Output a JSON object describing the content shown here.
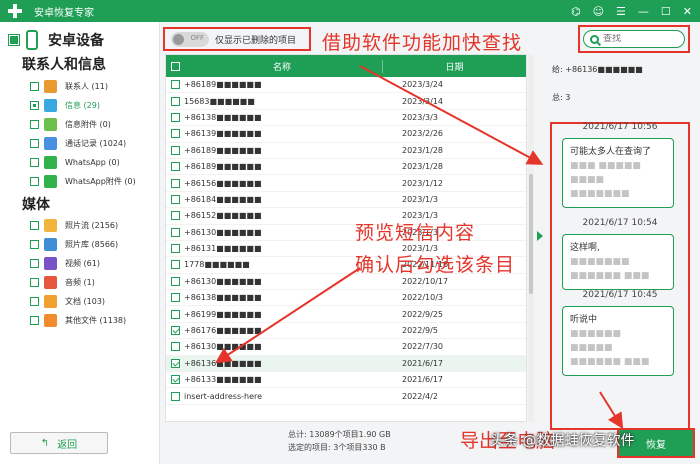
{
  "titlebar": {
    "title": "安卓恢复专家",
    "icons": [
      "wifi-icon",
      "chat-icon",
      "menu-icon",
      "minimize-icon",
      "maximize-icon",
      "close-icon"
    ]
  },
  "sidebar": {
    "device_name": "安卓设备",
    "section_contacts": "联系人和信息",
    "contacts_items": [
      {
        "label": "联系人 (11)",
        "icon": "contacts-icon",
        "color": "#e89a2e"
      },
      {
        "label": "信息 (29)",
        "icon": "messages-icon",
        "color": "#3aa7e0"
      },
      {
        "label": "信息附件 (0)",
        "icon": "attachment-icon",
        "color": "#6cc04a"
      },
      {
        "label": "通话记录 (1024)",
        "icon": "call-log-icon",
        "color": "#4a90e2"
      },
      {
        "label": "WhatsApp (0)",
        "icon": "whatsapp-icon",
        "color": "#2fb34a"
      },
      {
        "label": "WhatsApp附件 (0)",
        "icon": "whatsapp-attachment-icon",
        "color": "#2fb34a"
      }
    ],
    "section_media": "媒体",
    "media_items": [
      {
        "label": "照片流 (2156)",
        "icon": "photo-stream-icon",
        "color": "#f0b53a"
      },
      {
        "label": "照片库 (8566)",
        "icon": "photo-library-icon",
        "color": "#3f8fd8"
      },
      {
        "label": "视频 (61)",
        "icon": "video-icon",
        "color": "#7a52c7"
      },
      {
        "label": "音频 (1)",
        "icon": "audio-icon",
        "color": "#e6553d"
      },
      {
        "label": "文档 (103)",
        "icon": "document-icon",
        "color": "#f0a02e"
      },
      {
        "label": "其他文件 (1138)",
        "icon": "other-files-icon",
        "color": "#f08b2e"
      }
    ],
    "back_label": "返回"
  },
  "toolbar": {
    "toggle_state": "OFF",
    "toggle_label": "仅显示已删除的项目",
    "search_placeholder": "查找"
  },
  "annotations": {
    "top": "借助软件功能加快查找",
    "middle_line1": "预览短信内容",
    "middle_line2": "确认后勾选该条目",
    "bottom": "导出至电脑",
    "watermark": "头条 @数据蛙恢复软件"
  },
  "table": {
    "headers": {
      "name": "名称",
      "date": "日期"
    },
    "rows": [
      {
        "name": "+86189■■■■■■",
        "date": "2023/3/24",
        "checked": false,
        "highlight": false
      },
      {
        "name": "15683■■■■■■",
        "date": "2023/3/14",
        "checked": false,
        "highlight": false
      },
      {
        "name": "+86138■■■■■■",
        "date": "2023/3/3",
        "checked": false,
        "highlight": false
      },
      {
        "name": "+86139■■■■■■",
        "date": "2023/2/26",
        "checked": false,
        "highlight": false
      },
      {
        "name": "+86189■■■■■■",
        "date": "2023/1/28",
        "checked": false,
        "highlight": false
      },
      {
        "name": "+86189■■■■■■",
        "date": "2023/1/28",
        "checked": false,
        "highlight": false
      },
      {
        "name": "+86156■■■■■■",
        "date": "2023/1/12",
        "checked": false,
        "highlight": false
      },
      {
        "name": "+86184■■■■■■",
        "date": "2023/1/3",
        "checked": false,
        "highlight": false
      },
      {
        "name": "+86152■■■■■■",
        "date": "2023/1/3",
        "checked": false,
        "highlight": false
      },
      {
        "name": "+86130■■■■■■",
        "date": "2023/1/3",
        "checked": false,
        "highlight": false
      },
      {
        "name": "+86131■■■■■■",
        "date": "2023/1/3",
        "checked": false,
        "highlight": false
      },
      {
        "name": "1778■■■■■■",
        "date": "2022/11/16",
        "checked": false,
        "highlight": false
      },
      {
        "name": "+86130■■■■■■",
        "date": "2022/10/17",
        "checked": false,
        "highlight": false
      },
      {
        "name": "+86138■■■■■■",
        "date": "2022/10/3",
        "checked": false,
        "highlight": false
      },
      {
        "name": "+86199■■■■■■",
        "date": "2022/9/25",
        "checked": false,
        "highlight": false
      },
      {
        "name": "+86176■■■■■■",
        "date": "2022/9/5",
        "checked": true,
        "highlight": false
      },
      {
        "name": "+86130■■■■■■",
        "date": "2022/7/30",
        "checked": false,
        "highlight": false
      },
      {
        "name": "+86136■■■■■■",
        "date": "2021/6/17",
        "checked": true,
        "highlight": true
      },
      {
        "name": "+86133■■■■■■",
        "date": "2021/6/17",
        "checked": true,
        "highlight": false
      },
      {
        "name": "insert-address-here",
        "date": "2022/4/2",
        "checked": false,
        "highlight": false
      }
    ]
  },
  "totals": {
    "line1": "总计: 13089个项目1.90 GB",
    "line2": "选定的项目: 3个项目330 B"
  },
  "detail": {
    "to": "给: +86136■■■■■■",
    "total": "总: 3",
    "messages": [
      {
        "date": "2021/6/17 10:56",
        "text": "可能太多人在查询了",
        "blur": "■■■ ■■■■■ ■■■■ ■■■■■■■"
      },
      {
        "date": "2021/6/17 10:54",
        "text": "这样啊,",
        "blur": "■■■■■■■ ■■■■■■ ■■■"
      },
      {
        "date": "2021/6/17 10:45",
        "text": "听说中",
        "blur": "■■■■■■ ■■■■■ ■■■■■■ ■■■"
      }
    ],
    "export_label": "恢复"
  }
}
